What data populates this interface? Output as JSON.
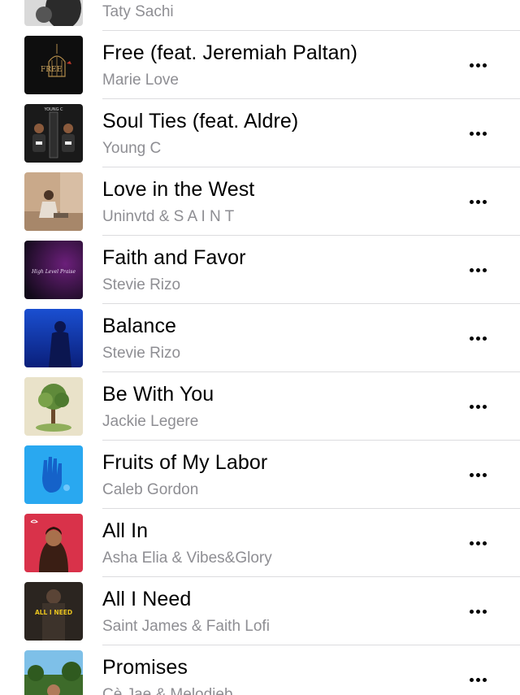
{
  "songs": [
    {
      "title": "",
      "artist": "Taty Sachi",
      "art": "art-dark-photo",
      "has_more": false
    },
    {
      "title": "Free (feat. Jeremiah Paltan)",
      "artist": "Marie Love",
      "art": "art-birdcage",
      "has_more": true
    },
    {
      "title": "Soul Ties (feat. Aldre)",
      "artist": "Young C",
      "art": "art-two-men",
      "has_more": true
    },
    {
      "title": "Love in the West",
      "artist": "Uninvtd & S A I N T",
      "art": "art-man-sitting",
      "has_more": true
    },
    {
      "title": "Faith and Favor",
      "artist": "Stevie Rizo",
      "art": "art-purple-script",
      "has_more": true
    },
    {
      "title": "Balance",
      "artist": "Stevie Rizo",
      "art": "art-blue-figure",
      "has_more": true
    },
    {
      "title": "Be With You",
      "artist": "Jackie Legere",
      "art": "art-tree",
      "has_more": true
    },
    {
      "title": "Fruits of My Labor",
      "artist": "Caleb Gordon",
      "art": "art-blue-hand",
      "has_more": true
    },
    {
      "title": "All In",
      "artist": "Asha Elia & Vibes&Glory",
      "art": "art-woman-red",
      "has_more": true
    },
    {
      "title": "All I Need",
      "artist": "Saint James & Faith Lofi",
      "art": "art-all-i-need",
      "has_more": true
    },
    {
      "title": "Promises",
      "artist": "Cè Jae & Melodieb",
      "art": "art-forest-scene",
      "has_more": true
    }
  ],
  "art_text": {
    "young_c": "YOUNG C",
    "all_i_need": "ALL I NEED",
    "faith_favor": "High Level Praise"
  },
  "more_icon": "more-horizontal-icon"
}
